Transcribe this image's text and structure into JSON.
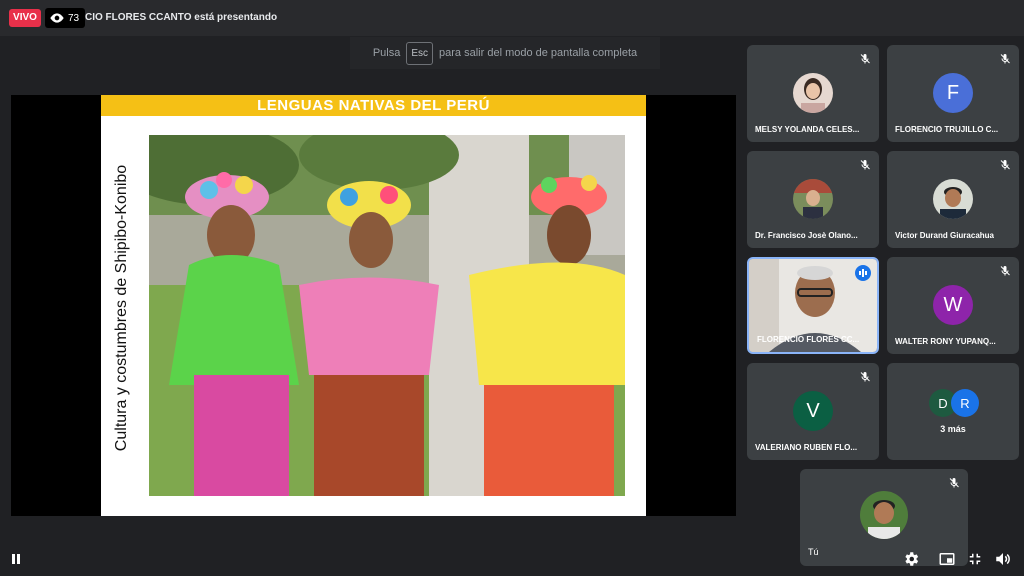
{
  "topbar": {
    "live_label": "VIVO",
    "viewers": "73",
    "presenter_text": "CIO FLORES CCANTO está presentando"
  },
  "fullscreen_hint": {
    "before": "Pulsa",
    "key": "Esc",
    "after": "para salir del modo de pantalla completa"
  },
  "slide": {
    "title": "LENGUAS NATIVAS DEL PERÚ",
    "vertical_text": "Cultura y costumbres de Shipibo-Konibo"
  },
  "participants": [
    {
      "name": "MELSY YOLANDA CELES...",
      "initial": "",
      "muted": true
    },
    {
      "name": "FLORENCIO TRUJILLO C...",
      "initial": "F",
      "avatar_color": "#4a6fd8",
      "muted": true
    },
    {
      "name": "Dr. Francisco Josè Olano...",
      "initial": "",
      "muted": true
    },
    {
      "name": "Victor Durand Giuracahua",
      "initial": "",
      "muted": true
    },
    {
      "name": "FLORENCIO FLORES CC...",
      "initial": "",
      "speaking": true
    },
    {
      "name": "WALTER RONY YUPANQ...",
      "initial": "W",
      "avatar_color": "#8e24aa",
      "muted": true
    },
    {
      "name": "VALERIANO RUBEN FLO...",
      "initial": "V",
      "avatar_color": "#0b5f43",
      "muted": true
    }
  ],
  "more": {
    "label": "3 más",
    "initials": [
      "D",
      "R"
    ],
    "colors": [
      "#1e5a40",
      "#1a73e8"
    ]
  },
  "self": {
    "name": "Tú"
  },
  "colors": {
    "background": "#202124",
    "tile": "#3c4043",
    "live": "#e8304a",
    "slide_banner": "#f5c015",
    "accent": "#8ab4f8"
  }
}
